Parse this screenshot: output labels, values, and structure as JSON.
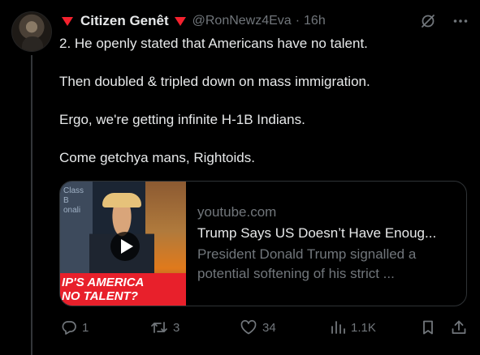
{
  "tweet": {
    "author": {
      "display_name": "Citizen Genêt",
      "handle": "@RonNewz4Eva",
      "separator": "·",
      "time": "16h"
    },
    "text": [
      "2. He openly stated that Americans have no talent.",
      "Then doubled & tripled down on mass immigration.",
      "Ergo, we're getting infinite H-1B Indians.",
      "Come getchya mans, Rightoids."
    ],
    "card": {
      "domain": "youtube.com",
      "title": "Trump Says US Doesn’t Have Enoug...",
      "description": "President Donald Trump signalled a potential softening of his strict ...",
      "thumbnail": {
        "banner_lines": [
          "IP'S AMERICA",
          "NO TALENT?"
        ],
        "bg_text_lines": [
          "Class",
          "B",
          "onali"
        ]
      }
    },
    "actions": {
      "replies": "1",
      "retweets": "3",
      "likes": "34",
      "views": "1.1K"
    }
  },
  "icons": {
    "flag": "red-triangle-flag-icon",
    "grok": "grok-icon",
    "more": "more-icon",
    "reply": "reply-icon",
    "retweet": "retweet-icon",
    "like": "heart-icon",
    "views": "views-icon",
    "bookmark": "bookmark-icon",
    "share": "share-icon"
  },
  "colors": {
    "background": "#000000",
    "text": "#e7e9ea",
    "muted": "#71767b",
    "flag": "#f4212e",
    "border": "#2f3336"
  }
}
